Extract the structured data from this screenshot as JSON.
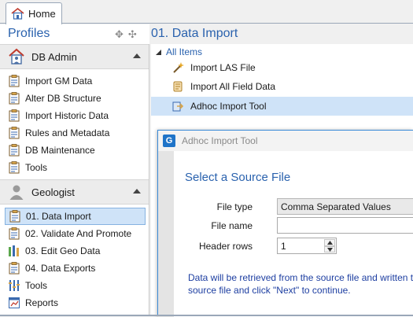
{
  "tabs": {
    "home_label": "Home"
  },
  "profiles": {
    "title": "Profiles"
  },
  "main": {
    "title": "01. Data Import"
  },
  "sidebar": {
    "sections": [
      {
        "title": "DB Admin",
        "items": [
          {
            "label": "Import GM Data"
          },
          {
            "label": "Alter DB Structure"
          },
          {
            "label": "Import Historic Data"
          },
          {
            "label": "Rules and Metadata"
          },
          {
            "label": "DB Maintenance"
          },
          {
            "label": "Tools"
          }
        ]
      },
      {
        "title": "Geologist",
        "items": [
          {
            "label": "01. Data Import",
            "active": true
          },
          {
            "label": "02. Validate And Promote"
          },
          {
            "label": "03. Edit Geo Data"
          },
          {
            "label": "04. Data Exports"
          },
          {
            "label": "Tools"
          },
          {
            "label": "Reports"
          }
        ]
      }
    ]
  },
  "items_panel": {
    "group_label": "All Items",
    "items": [
      {
        "label": "Import LAS File"
      },
      {
        "label": "Import All Field Data"
      },
      {
        "label": "Adhoc Import Tool",
        "selected": true
      }
    ]
  },
  "dialog": {
    "title": "Adhoc Import Tool",
    "logo_letter": "G",
    "heading": "Select a Source File",
    "file_type_label": "File type",
    "file_type_value": "Comma Separated Values",
    "file_name_label": "File name",
    "file_name_value": "",
    "header_rows_label": "Header rows",
    "header_rows_value": "1",
    "info_line1": "Data will be retrieved from the source file and written t",
    "info_line2": "source file and click \"Next\" to continue."
  },
  "colors": {
    "accent_blue": "#2a62ae",
    "selection_bg": "#cfe3f8",
    "info_text": "#1d3ea1"
  }
}
